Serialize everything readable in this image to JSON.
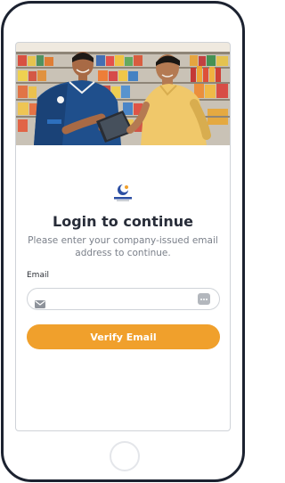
{
  "hero": {
    "image_name": "store-staff-with-tablet-photo"
  },
  "brand": {
    "logo_name": "crescent-logo-icon",
    "logo_text": "CRESCENT"
  },
  "login": {
    "title": "Login to continue",
    "subtitle": "Please enter your company-issued email address to continue.",
    "email_label": "Email",
    "email_value": "",
    "email_placeholder": "",
    "verify_button": "Verify Email"
  },
  "icons": {
    "email": "mail-icon",
    "autofill": "autofill-key-icon"
  },
  "colors": {
    "accent": "#f0a02c",
    "title": "#272c38",
    "muted": "#7b808a",
    "frame": "#1c2230"
  }
}
